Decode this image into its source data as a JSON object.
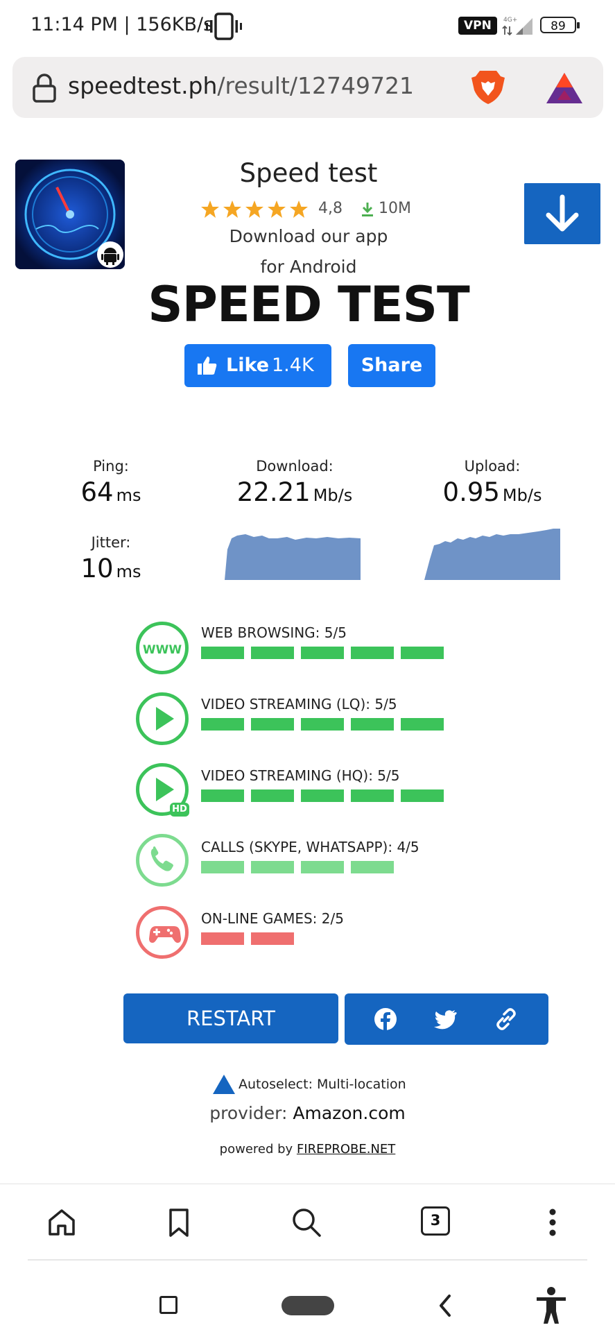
{
  "status_bar": {
    "time": "11:14 PM | 156KB/s",
    "vpn": "VPN",
    "network": "4G+",
    "battery": "89"
  },
  "browser": {
    "url_domain": "speedtest.ph",
    "url_path": "/result/12749721"
  },
  "app_promo": {
    "title": "Speed test",
    "rating": "4,8",
    "downloads": "10M",
    "line1": "Download our app",
    "line2": "for Android"
  },
  "heading": "SPEED TEST",
  "social": {
    "like_label": "Like",
    "like_count": "1.4K",
    "share_label": "Share"
  },
  "metrics": {
    "ping_label": "Ping:",
    "ping_value": "64",
    "ping_unit": "ms",
    "jitter_label": "Jitter:",
    "jitter_value": "10",
    "jitter_unit": "ms",
    "download_label": "Download:",
    "download_value": "22.21",
    "download_unit": "Mb/s",
    "upload_label": "Upload:",
    "upload_value": "0.95",
    "upload_unit": "Mb/s"
  },
  "quality": [
    {
      "label": "WEB BROWSING: 5/5",
      "score": 5,
      "max": 5,
      "color": "#3cc35a",
      "icon": "www-icon"
    },
    {
      "label": "VIDEO STREAMING (LQ): 5/5",
      "score": 5,
      "max": 5,
      "color": "#3cc35a",
      "icon": "play-icon"
    },
    {
      "label": "VIDEO STREAMING (HQ): 5/5",
      "score": 5,
      "max": 5,
      "color": "#3cc35a",
      "icon": "play-hd-icon"
    },
    {
      "label": "CALLS (SKYPE, WHATSAPP): 4/5",
      "score": 4,
      "max": 5,
      "color": "#7ddb8f",
      "icon": "phone-icon"
    },
    {
      "label": "ON-LINE GAMES: 2/5",
      "score": 2,
      "max": 5,
      "color": "#ef6f6f",
      "icon": "gamepad-icon"
    }
  ],
  "actions": {
    "restart_label": "RESTART"
  },
  "footer": {
    "server": "Autoselect: Multi-location",
    "provider_prefix": "provider:",
    "provider_name": "Amazon.com",
    "powered_prefix": "powered by",
    "powered_link": "FIREPROBE.NET"
  },
  "nav": {
    "tabs_count": "3"
  },
  "colors": {
    "accent_blue": "#1565c0",
    "facebook_blue": "#1877f2",
    "graph_fill": "#6f93c7",
    "good_green": "#3cc35a",
    "bad_red": "#ef6f6f"
  }
}
